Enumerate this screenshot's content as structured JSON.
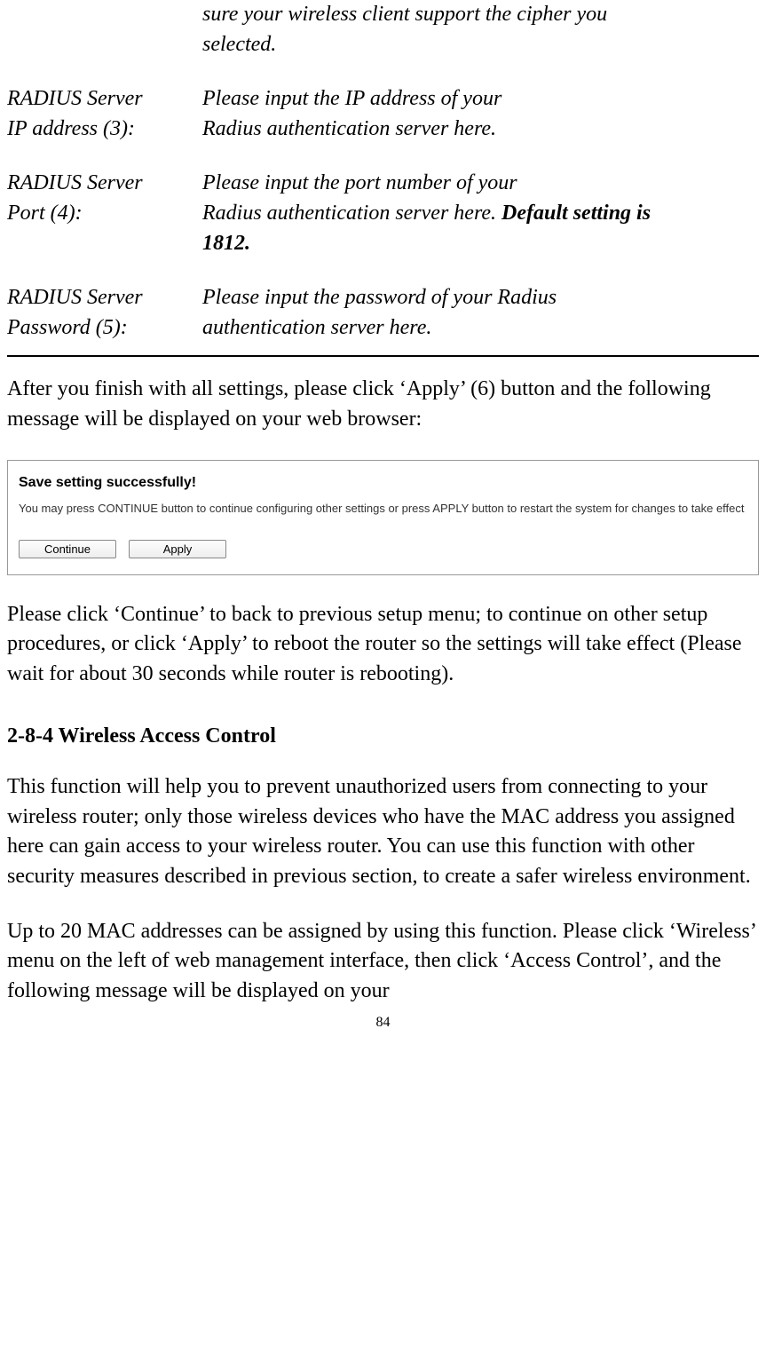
{
  "definitions": {
    "partial_cipher_line1": "sure your wireless client support the cipher you",
    "partial_cipher_line2": "selected.",
    "radius_ip_label_line1": "RADIUS Server",
    "radius_ip_label_line2": "IP address (3):",
    "radius_ip_desc_line1": "Please input the IP address of your",
    "radius_ip_desc_line2": "Radius authentication server here.",
    "radius_port_label_line1": "RADIUS Server",
    "radius_port_label_line2": "Port (4):",
    "radius_port_desc_line1": "Please input the port number of your",
    "radius_port_desc_line2a": "Radius authentication server here. ",
    "radius_port_desc_line2b": "Default setting is",
    "radius_port_desc_line3": "1812.",
    "radius_pw_label_line1": "RADIUS Server",
    "radius_pw_label_line2": "Password (5):",
    "radius_pw_desc_line1": "Please input the password of your Radius",
    "radius_pw_desc_line2": "authentication server here."
  },
  "paragraph_after_defs": "After you finish with all settings, please click ‘Apply’ (6) button and the following message will be displayed on your web browser:",
  "dialog": {
    "title": "Save setting successfully!",
    "message": "You may press CONTINUE button to continue configuring other settings or press APPLY button to restart the system for changes to take effect",
    "continue_label": "Continue",
    "apply_label": "Apply"
  },
  "paragraph_after_dialog": "Please click ‘Continue’ to back to previous setup menu; to continue on other setup procedures, or click ‘Apply’ to reboot the router so the settings will take effect (Please wait for about 30 seconds while router is rebooting).",
  "section_heading": "2-8-4 Wireless Access Control",
  "section_para1": "This function will help you to prevent unauthorized users from connecting to your wireless router; only those wireless devices who have the MAC address you assigned here can gain access to your wireless router. You can use this function with other security measures described in previous section, to create a safer wireless environment.",
  "section_para2": "Up to 20 MAC addresses can be assigned by using this function. Please click ‘Wireless’ menu on the left of web management interface, then click ‘Access Control’, and the following message will be displayed on your",
  "page_number": "84"
}
